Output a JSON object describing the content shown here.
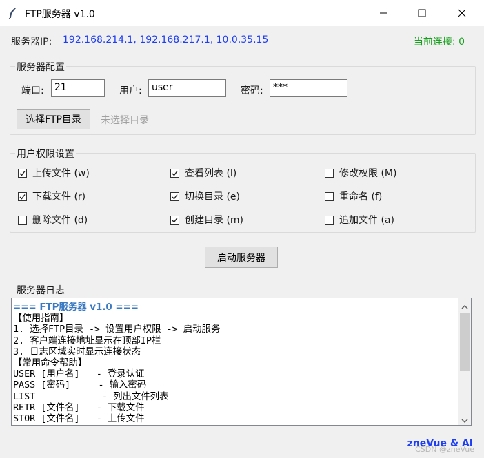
{
  "window": {
    "title": "FTP服务器 v1.0"
  },
  "server_ip": {
    "label": "服务器IP:",
    "value": "192.168.214.1, 192.168.217.1, 10.0.35.15"
  },
  "connections": {
    "text": "当前连接: 0"
  },
  "config": {
    "title": "服务器配置",
    "port": {
      "label": "端口:",
      "value": "21"
    },
    "user": {
      "label": "用户:",
      "value": "user"
    },
    "password": {
      "label": "密码:",
      "value": "***"
    },
    "choose_dir_button": "选择FTP目录",
    "dir_status": "未选择目录"
  },
  "permissions": {
    "title": "用户权限设置",
    "items": [
      {
        "label": "上传文件 (w)",
        "checked": true
      },
      {
        "label": "查看列表 (l)",
        "checked": true
      },
      {
        "label": "修改权限 (M)",
        "checked": false
      },
      {
        "label": "下载文件 (r)",
        "checked": true
      },
      {
        "label": "切换目录 (e)",
        "checked": true
      },
      {
        "label": "重命名 (f)",
        "checked": false
      },
      {
        "label": "删除文件 (d)",
        "checked": false
      },
      {
        "label": "创建目录 (m)",
        "checked": true
      },
      {
        "label": "追加文件 (a)",
        "checked": false
      }
    ]
  },
  "start_button": "启动服务器",
  "log": {
    "title": "服务器日志",
    "heading": "=== FTP服务器 v1.0 ===",
    "lines": [
      "【使用指南】",
      "1. 选择FTP目录 -> 设置用户权限 -> 启动服务",
      "2. 客户端连接地址显示在顶部IP栏",
      "3. 日志区域实时显示连接状态",
      "【常用命令帮助】",
      "USER [用户名]   - 登录认证",
      "PASS [密码]     - 输入密码",
      "LIST            - 列出文件列表",
      "RETR [文件名]   - 下载文件",
      "STOR [文件名]   - 上传文件"
    ]
  },
  "footer": "zneVue & AI",
  "watermark": "CSDN @zneVue"
}
